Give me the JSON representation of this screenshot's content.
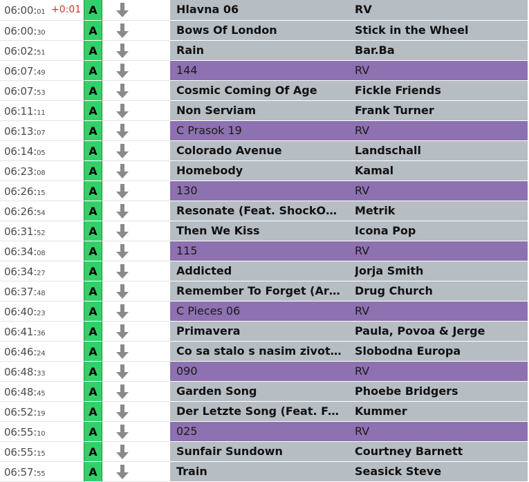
{
  "playlist": {
    "rows": [
      {
        "time_main": "06:00:",
        "time_sec": "01",
        "offset": "+0:01",
        "badge": "A",
        "title": "Hlavna 06",
        "artist": "RV",
        "kind": "separator-top"
      },
      {
        "time_main": "06:00:",
        "time_sec": "30",
        "offset": "",
        "badge": "A",
        "title": "Bows Of London",
        "artist": "Stick in the Wheel",
        "kind": "song"
      },
      {
        "time_main": "06:02:",
        "time_sec": "51",
        "offset": "",
        "badge": "A",
        "title": "Rain",
        "artist": "Bar.Ba",
        "kind": "song"
      },
      {
        "time_main": "06:07:",
        "time_sec": "49",
        "offset": "",
        "badge": "A",
        "title": "144",
        "artist": "RV",
        "kind": "separator"
      },
      {
        "time_main": "06:07:",
        "time_sec": "53",
        "offset": "",
        "badge": "A",
        "title": "Cosmic Coming Of Age",
        "artist": "Fickle Friends",
        "kind": "song"
      },
      {
        "time_main": "06:11:",
        "time_sec": "11",
        "offset": "",
        "badge": "A",
        "title": "Non Serviam",
        "artist": "Frank Turner",
        "kind": "song"
      },
      {
        "time_main": "06:13:",
        "time_sec": "07",
        "offset": "",
        "badge": "A",
        "title": "C Prasok 19",
        "artist": "RV",
        "kind": "separator"
      },
      {
        "time_main": "06:14:",
        "time_sec": "05",
        "offset": "",
        "badge": "A",
        "title": "Colorado Avenue",
        "artist": "Landschall",
        "kind": "song"
      },
      {
        "time_main": "06:23:",
        "time_sec": "08",
        "offset": "",
        "badge": "A",
        "title": "Homebody",
        "artist": "Kamal",
        "kind": "song"
      },
      {
        "time_main": "06:26:",
        "time_sec": "15",
        "offset": "",
        "badge": "A",
        "title": "130",
        "artist": "RV",
        "kind": "separator"
      },
      {
        "time_main": "06:26:",
        "time_sec": "54",
        "offset": "",
        "badge": "A",
        "title": "Resonate (Feat. ShockOne)",
        "artist": "Metrik",
        "kind": "song"
      },
      {
        "time_main": "06:31:",
        "time_sec": "52",
        "offset": "",
        "badge": "A",
        "title": "Then We Kiss",
        "artist": "Icona Pop",
        "kind": "song"
      },
      {
        "time_main": "06:34:",
        "time_sec": "08",
        "offset": "",
        "badge": "A",
        "title": "115",
        "artist": "RV",
        "kind": "separator"
      },
      {
        "time_main": "06:34:",
        "time_sec": "27",
        "offset": "",
        "badge": "A",
        "title": "Addicted",
        "artist": "Jorja Smith",
        "kind": "song"
      },
      {
        "time_main": "06:37:",
        "time_sec": "48",
        "offset": "",
        "badge": "A",
        "title": "Remember To Forget (Arcw...",
        "artist": "Drug Church",
        "kind": "song"
      },
      {
        "time_main": "06:40:",
        "time_sec": "23",
        "offset": "",
        "badge": "A",
        "title": "C Pieces 06",
        "artist": "RV",
        "kind": "separator"
      },
      {
        "time_main": "06:41:",
        "time_sec": "36",
        "offset": "",
        "badge": "A",
        "title": "Primavera",
        "artist": "Paula, Povoa & Jerge",
        "kind": "song"
      },
      {
        "time_main": "06:46:",
        "time_sec": "24",
        "offset": "",
        "badge": "A",
        "title": "Co sa stalo s nasim zivotom",
        "artist": "Slobodna Europa",
        "kind": "song"
      },
      {
        "time_main": "06:48:",
        "time_sec": "33",
        "offset": "",
        "badge": "A",
        "title": "090",
        "artist": "RV",
        "kind": "separator"
      },
      {
        "time_main": "06:48:",
        "time_sec": "45",
        "offset": "",
        "badge": "A",
        "title": "Garden Song",
        "artist": "Phoebe Bridgers",
        "kind": "song"
      },
      {
        "time_main": "06:52:",
        "time_sec": "19",
        "offset": "",
        "badge": "A",
        "title": "Der Letzte Song (Feat. Fred ...",
        "artist": "Kummer",
        "kind": "song"
      },
      {
        "time_main": "06:55:",
        "time_sec": "10",
        "offset": "",
        "badge": "A",
        "title": "025",
        "artist": "RV",
        "kind": "separator"
      },
      {
        "time_main": "06:55:",
        "time_sec": "15",
        "offset": "",
        "badge": "A",
        "title": "Sunfair Sundown",
        "artist": "Courtney Barnett",
        "kind": "song"
      },
      {
        "time_main": "06:57:",
        "time_sec": "55",
        "offset": "",
        "badge": "A",
        "title": "Train",
        "artist": "Seasick Steve",
        "kind": "song"
      }
    ],
    "colors": {
      "badge_green": "#33d06a",
      "song_bg": "#b6bdc3",
      "separator_bg": "#8e71b1",
      "offset_red": "#c0392b"
    },
    "icons": {
      "row_action": "arrow-down-icon"
    }
  }
}
